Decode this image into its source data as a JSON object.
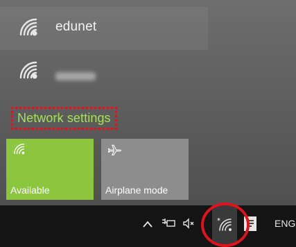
{
  "networks": [
    {
      "name": "edunet",
      "connected": false
    },
    {
      "name": "",
      "connected": false,
      "name_obscured": true
    }
  ],
  "network_settings_label": "Network settings",
  "quick_actions": [
    {
      "label": "Available",
      "icon": "wifi-icon",
      "active": true
    },
    {
      "label": "Airplane mode",
      "icon": "airplane-icon",
      "active": false
    }
  ],
  "taskbar": {
    "language": "ENG",
    "icons": [
      "chevron-up-icon",
      "power-plug-icon",
      "speaker-muted-icon",
      "wifi-icon",
      "action-center-icon"
    ]
  },
  "colors": {
    "accent_green": "#8cc63f",
    "settings_link": "#a8e05a",
    "highlight_red": "#e0121a"
  }
}
